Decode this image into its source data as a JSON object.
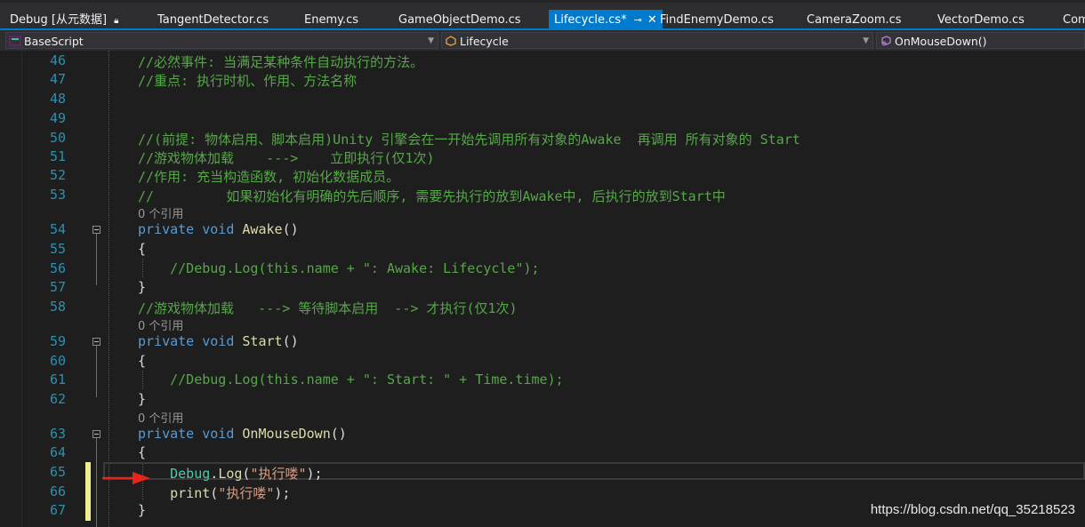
{
  "tabs": [
    {
      "label": "Debug [从元数据]",
      "icon": "lock-icon",
      "active": false
    },
    {
      "label": "TangentDetector.cs",
      "active": false
    },
    {
      "label": "Enemy.cs",
      "active": false
    },
    {
      "label": "GameObjectDemo.cs",
      "active": false
    },
    {
      "label": "Lifecycle.cs*",
      "active": true
    },
    {
      "label": "FindEnemyDemo.cs",
      "active": false
    },
    {
      "label": "CameraZoom.cs",
      "active": false
    },
    {
      "label": "VectorDemo.cs",
      "active": false
    },
    {
      "label": "Com",
      "active": false
    }
  ],
  "navbar": {
    "project": "BaseScript",
    "type": "Lifecycle",
    "member": "OnMouseDown()"
  },
  "lines": [
    {
      "num": "46",
      "text": "//必然事件: 当满足某种条件自动执行的方法。"
    },
    {
      "num": "47",
      "text": "//重点: 执行时机、作用、方法名称"
    },
    {
      "num": "48",
      "text": ""
    },
    {
      "num": "49",
      "text": ""
    },
    {
      "num": "50",
      "text": "//(前提: 物体启用、脚本启用)Unity 引擎会在一开始先调用所有对象的Awake  再调用 所有对象的 Start"
    },
    {
      "num": "51",
      "text": "//游戏物体加载    --->    立即执行(仅1次)"
    },
    {
      "num": "52",
      "text": "//作用: 充当构造函数, 初始化数据成员。"
    },
    {
      "num": "53",
      "text": "//         如果初始化有明确的先后顺序, 需要先执行的放到Awake中, 后执行的放到Start中"
    },
    {
      "num": "54",
      "ref": "0 个引用",
      "kw": "private void",
      "name": "Awake",
      "rest": "()"
    },
    {
      "num": "55",
      "text": "{"
    },
    {
      "num": "56",
      "text": "    //Debug.Log(this.name + \": Awake: Lifecycle\");"
    },
    {
      "num": "57",
      "text": "}"
    },
    {
      "num": "58",
      "text": "//游戏物体加载   ---> 等待脚本启用  --> 才执行(仅1次)"
    },
    {
      "num": "59",
      "ref": "0 个引用",
      "kw": "private void",
      "name": "Start",
      "rest": "()"
    },
    {
      "num": "60",
      "text": "{"
    },
    {
      "num": "61",
      "text": "    //Debug.Log(this.name + \": Start: \" + Time.time);"
    },
    {
      "num": "62",
      "text": "}"
    },
    {
      "num": "63",
      "ref": "0 个引用",
      "kw": "private void",
      "name": "OnMouseDown",
      "rest": "()"
    },
    {
      "num": "64",
      "text": "{"
    },
    {
      "num": "65",
      "cls": "Debug",
      "method": "Log",
      "str": "\"执行喽\"",
      "end": ");"
    },
    {
      "num": "66",
      "method": "print",
      "str": "\"执行喽\"",
      "end": ");"
    },
    {
      "num": "67",
      "text": "}"
    }
  ],
  "watermark": "https://blog.csdn.net/qq_35218523",
  "colors": {
    "accent": "#007acc",
    "comment": "#57a64a",
    "keyword": "#569cd6",
    "method": "#dcdcaa",
    "string": "#d69d85",
    "linenumber": "#2b91af",
    "arrow": "#e8231a",
    "changebar": "#efef91"
  }
}
